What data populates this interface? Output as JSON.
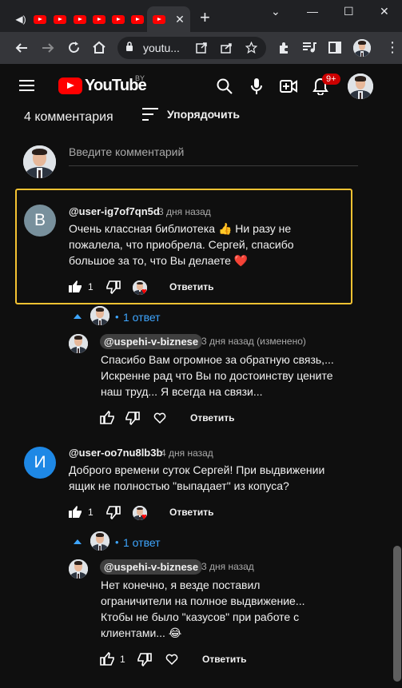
{
  "browser": {
    "tab_count_youtube": 8,
    "active_tab_close": "✕",
    "new_tab": "+",
    "window_controls": [
      "⌄",
      "—",
      "☐",
      "✕"
    ],
    "url": "youtu...",
    "nav_icons": [
      "back-arrow-icon",
      "forward-arrow-icon",
      "reload-icon",
      "home-icon"
    ],
    "extension_icons": [
      "open-in-app-icon",
      "share-icon",
      "bookmark-star-icon",
      "puzzle-icon",
      "media-icon",
      "sidepanel-icon"
    ],
    "menu_icon": "⋮"
  },
  "header": {
    "logo_text": "YouTube",
    "country_code": "BY",
    "notifications_badge": "9+"
  },
  "comments_section": {
    "count_label": "4 комментария",
    "sort_label": "Упорядочить",
    "add_comment_placeholder": "Введите комментарий"
  },
  "comments": [
    {
      "avatar_letter": "В",
      "avatar_color": "#78909c",
      "author": "@user-ig7of7qn5d",
      "time": "3 дня назад",
      "text_lines": [
        "Очень классная библиотека 👍 Ни разу не",
        "пожалела, что приобрела. Сергей, спасибо",
        "большое за то, что Вы делаете ❤️"
      ],
      "likes": "1",
      "reply_label": "Ответить",
      "highlighted": true,
      "replies_count_label": "1 ответ",
      "reply": {
        "author": "@uspehi-v-biznese",
        "time": "3 дня назад (изменено)",
        "text_lines": [
          "Спасибо Вам огромное за обратную связь,...",
          "Искренне рад что Вы по достоинству цените",
          "наш труд... Я всегда на связи..."
        ],
        "likes": "",
        "reply_label": "Ответить"
      }
    },
    {
      "avatar_letter": "И",
      "avatar_color": "#1e88e5",
      "author": "@user-oo7nu8lb3b",
      "time": "4 дня назад",
      "text_lines": [
        "Доброго времени суток Сергей! При выдвижении",
        "ящик не полностью \"выпадает\" из копуса?"
      ],
      "likes": "1",
      "reply_label": "Ответить",
      "highlighted": false,
      "replies_count_label": "1 ответ",
      "reply": {
        "author": "@uspehi-v-biznese",
        "time": "3 дня назад",
        "text_lines": [
          "Нет конечно,  я везде поставил",
          "ограничители на полное выдвижение...",
          "Ктобы не было \"казусов\" при работе с",
          "клиентами... 😂"
        ],
        "likes": "1",
        "reply_label": "Ответить"
      }
    }
  ],
  "colors": {
    "background": "#0f0f0f",
    "highlight_border": "#f5c232",
    "link_blue": "#3ea6ff",
    "brand_red": "#ff0000"
  }
}
